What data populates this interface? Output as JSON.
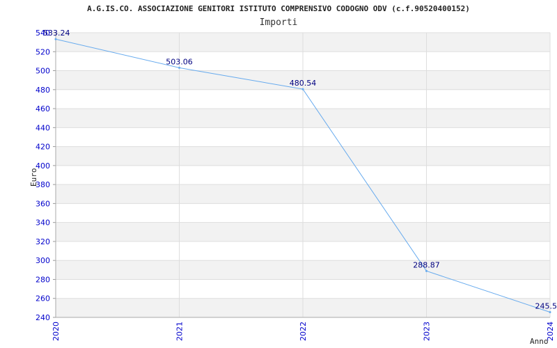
{
  "chart_data": {
    "type": "line",
    "title": "A.G.IS.CO. ASSOCIAZIONE GENITORI ISTITUTO COMPRENSIVO CODOGNO ODV (c.f.90520400152)",
    "subtitle": "Importi",
    "xlabel": "Anno",
    "ylabel": "Euro",
    "categories": [
      "2020",
      "2021",
      "2022",
      "2023",
      "2024"
    ],
    "series": [
      {
        "values": [
          533.24,
          503.06,
          480.54,
          288.87,
          245.5
        ]
      }
    ],
    "data_labels": [
      "533.24",
      "503.06",
      "480.54",
      "288.87",
      "245.5"
    ],
    "yticks": [
      240,
      260,
      280,
      300,
      320,
      340,
      360,
      380,
      400,
      420,
      440,
      460,
      480,
      500,
      520,
      540
    ],
    "ylim": [
      240,
      540
    ],
    "grid": true,
    "line_color": "#66aaee",
    "tick_color": "#0000cc",
    "label_color": "#000080",
    "band_color": "#f2f2f2"
  }
}
